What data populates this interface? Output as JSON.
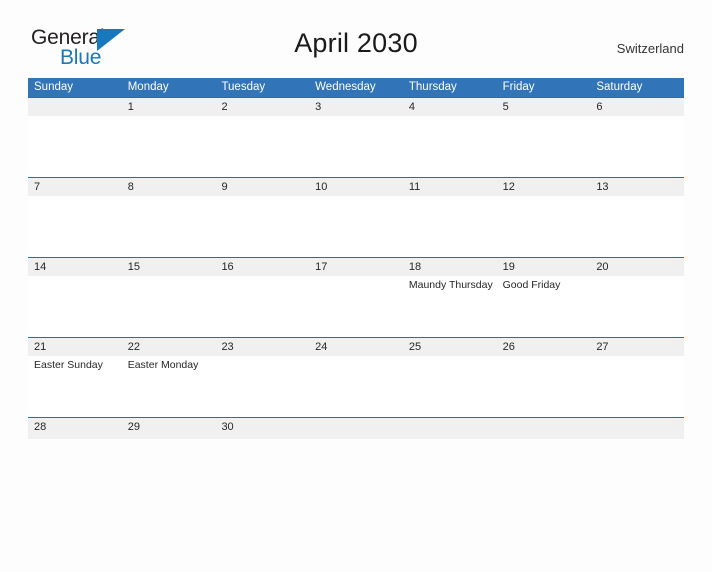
{
  "brand": {
    "name_part1": "General",
    "name_part2": "Blue",
    "flag_icon": "flag-triangle-icon",
    "accent_color": "#1878be"
  },
  "header": {
    "title": "April 2030",
    "country": "Switzerland"
  },
  "colors": {
    "header_blue": "#3174b8",
    "row_band_gray": "#f0f0f0",
    "row_divider": "#2e6da4",
    "page_background": "#fdfdfd",
    "text": "#262626"
  },
  "calendar": {
    "month": "April",
    "year": 2030,
    "weekday_headers": [
      "Sunday",
      "Monday",
      "Tuesday",
      "Wednesday",
      "Thursday",
      "Friday",
      "Saturday"
    ],
    "weeks": [
      [
        {
          "day": "",
          "event": ""
        },
        {
          "day": "1",
          "event": ""
        },
        {
          "day": "2",
          "event": ""
        },
        {
          "day": "3",
          "event": ""
        },
        {
          "day": "4",
          "event": ""
        },
        {
          "day": "5",
          "event": ""
        },
        {
          "day": "6",
          "event": ""
        }
      ],
      [
        {
          "day": "7",
          "event": ""
        },
        {
          "day": "8",
          "event": ""
        },
        {
          "day": "9",
          "event": ""
        },
        {
          "day": "10",
          "event": ""
        },
        {
          "day": "11",
          "event": ""
        },
        {
          "day": "12",
          "event": ""
        },
        {
          "day": "13",
          "event": ""
        }
      ],
      [
        {
          "day": "14",
          "event": ""
        },
        {
          "day": "15",
          "event": ""
        },
        {
          "day": "16",
          "event": ""
        },
        {
          "day": "17",
          "event": ""
        },
        {
          "day": "18",
          "event": "Maundy Thursday"
        },
        {
          "day": "19",
          "event": "Good Friday"
        },
        {
          "day": "20",
          "event": ""
        }
      ],
      [
        {
          "day": "21",
          "event": "Easter Sunday"
        },
        {
          "day": "22",
          "event": "Easter Monday"
        },
        {
          "day": "23",
          "event": ""
        },
        {
          "day": "24",
          "event": ""
        },
        {
          "day": "25",
          "event": ""
        },
        {
          "day": "26",
          "event": ""
        },
        {
          "day": "27",
          "event": ""
        }
      ],
      [
        {
          "day": "28",
          "event": ""
        },
        {
          "day": "29",
          "event": ""
        },
        {
          "day": "30",
          "event": ""
        },
        {
          "day": "",
          "event": ""
        },
        {
          "day": "",
          "event": ""
        },
        {
          "day": "",
          "event": ""
        },
        {
          "day": "",
          "event": ""
        }
      ]
    ]
  }
}
